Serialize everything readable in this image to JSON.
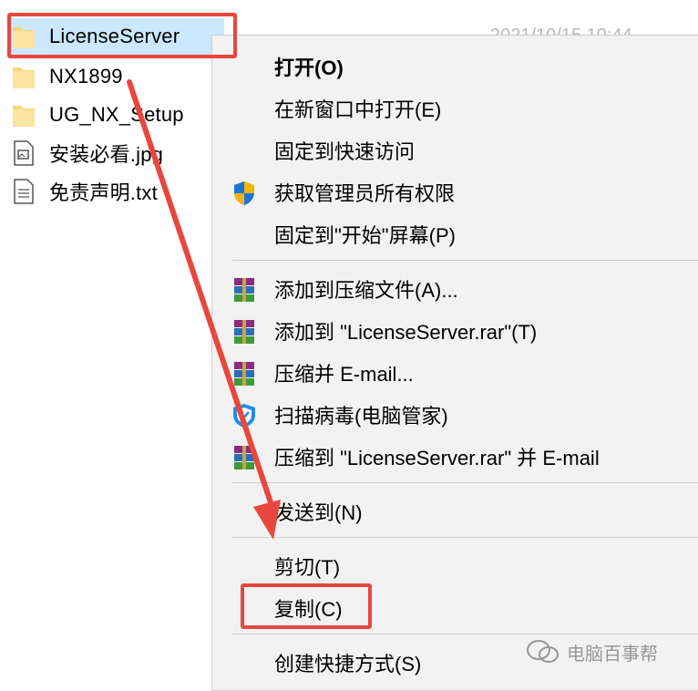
{
  "file_list": {
    "items": [
      {
        "name": "LicenseServer",
        "icon": "folder-icon",
        "selected": true
      },
      {
        "name": "NX1899",
        "icon": "folder-icon"
      },
      {
        "name": "UG_NX_Setup",
        "icon": "folder-icon"
      },
      {
        "name": "安装必看.jpg",
        "icon": "image-file-icon"
      },
      {
        "name": "免责声明.txt",
        "icon": "text-file-icon"
      }
    ],
    "modified_date": "2021/10/15 10:44"
  },
  "context_menu": {
    "items": [
      {
        "label": "打开(O)",
        "icon": null
      },
      {
        "label": "在新窗口中打开(E)",
        "icon": null
      },
      {
        "label": "固定到快速访问",
        "icon": null
      },
      {
        "label": "获取管理员所有权限",
        "icon": "uac-shield-icon"
      },
      {
        "label": "固定到\"开始\"屏幕(P)",
        "icon": null
      },
      {
        "label": "添加到压缩文件(A)...",
        "icon": "winrar-icon"
      },
      {
        "label": "添加到 \"LicenseServer.rar\"(T)",
        "icon": "winrar-icon"
      },
      {
        "label": "压缩并 E-mail...",
        "icon": "winrar-icon"
      },
      {
        "label": "扫描病毒(电脑管家)",
        "icon": "tencent-shield-icon"
      },
      {
        "label": "压缩到 \"LicenseServer.rar\" 并 E-mail",
        "icon": "winrar-icon"
      },
      {
        "label": "发送到(N)",
        "icon": null
      },
      {
        "label": "剪切(T)",
        "icon": null
      },
      {
        "label": "复制(C)",
        "icon": null
      },
      {
        "label": "创建快捷方式(S)",
        "icon": null
      }
    ]
  },
  "annotations": {
    "highlight_color": "#e8473f",
    "watermark_text": "电脑百事帮"
  },
  "colors": {
    "selection": "#cce8ff",
    "menu_background": "#f2f2f2",
    "folder": "#f8d775"
  }
}
